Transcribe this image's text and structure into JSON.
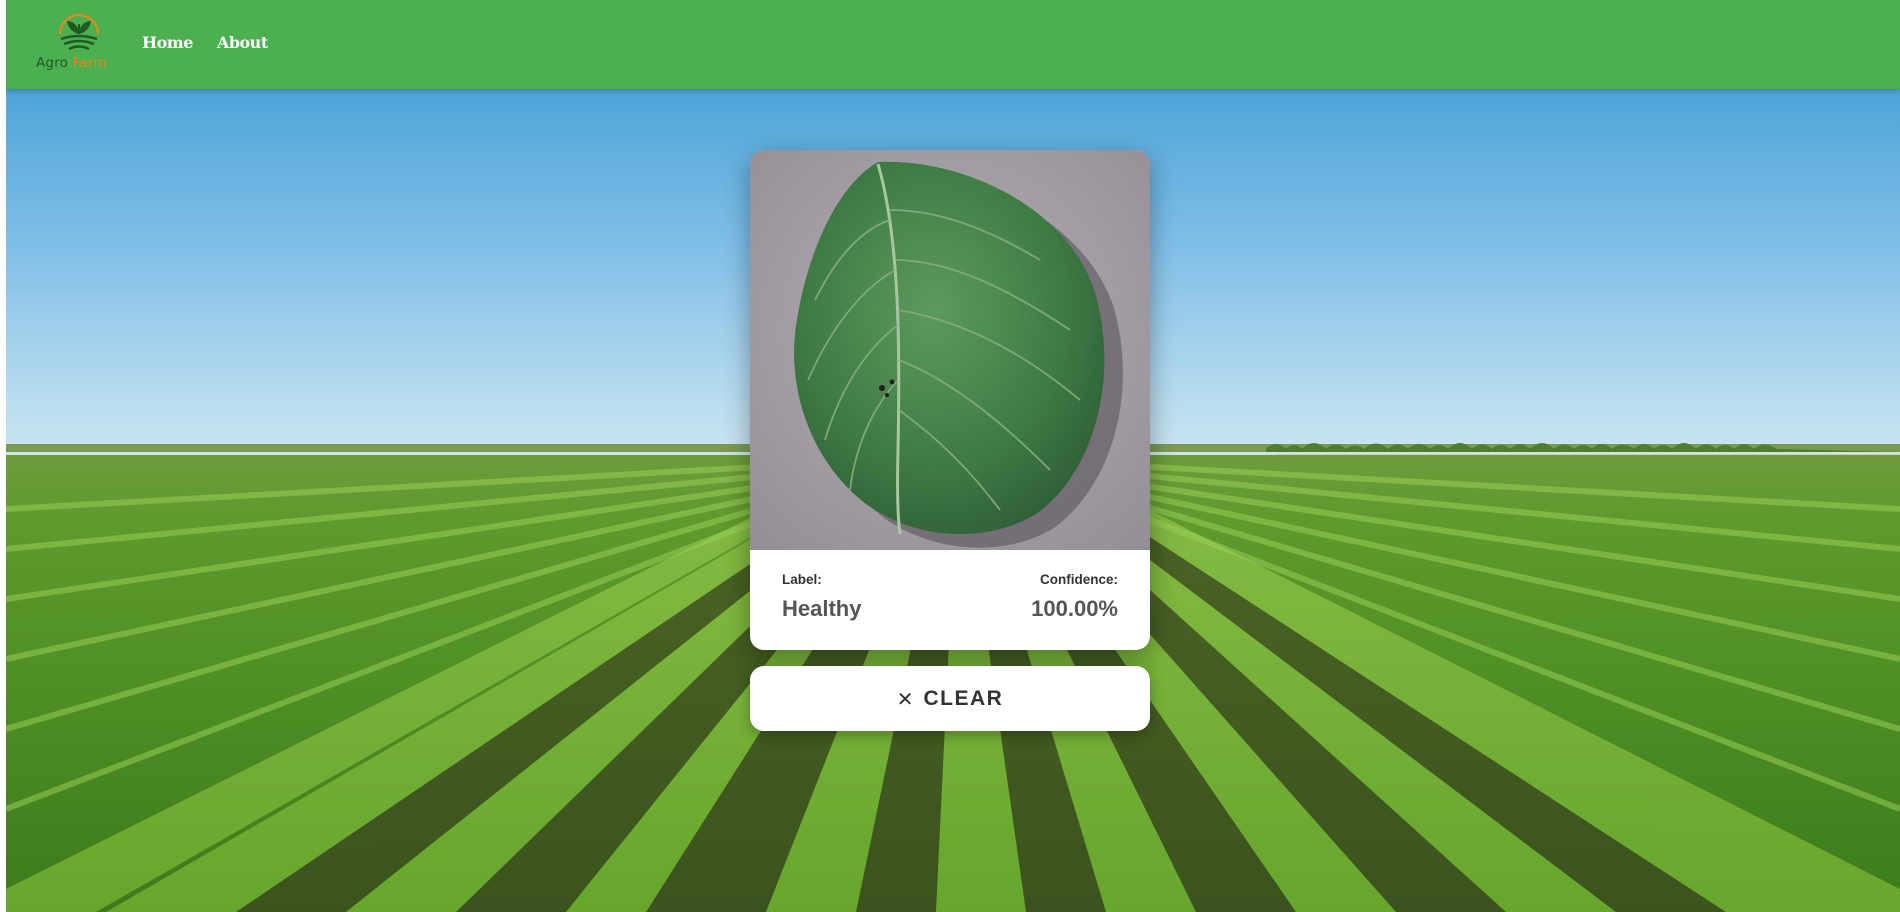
{
  "brand": {
    "name_part1": "Agro",
    "name_part2": "Farm",
    "logo_icon": "sprout-sunrise-logo-icon"
  },
  "nav": {
    "items": [
      {
        "label": "Home"
      },
      {
        "label": "About"
      }
    ]
  },
  "prediction": {
    "image_icon": "potato-leaf-photo",
    "label_title": "Label:",
    "label_value": "Healthy",
    "confidence_title": "Confidence:",
    "confidence_value": "100.00%"
  },
  "clear_button": {
    "icon": "close-icon",
    "icon_glyph": "✕",
    "label": "CLEAR"
  },
  "colors": {
    "navbar": "#4caf50",
    "brand_dark": "#1f5a24",
    "brand_orange": "#e08a1e",
    "card": "#ffffff",
    "text_dark": "#333333",
    "text_mid": "#555555"
  }
}
